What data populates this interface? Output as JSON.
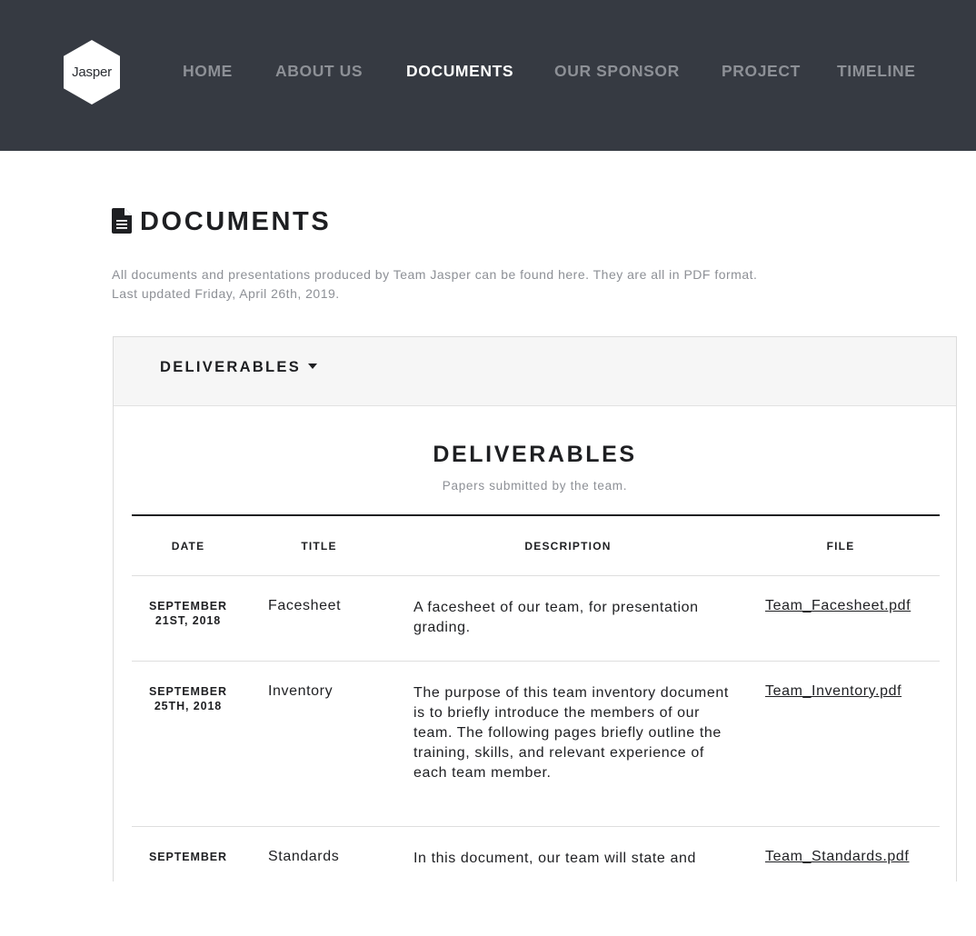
{
  "header": {
    "logo_text": "Jasper",
    "nav": [
      {
        "label": "HOME",
        "active": false
      },
      {
        "label": "ABOUT US",
        "active": false
      },
      {
        "label": "DOCUMENTS",
        "active": true
      },
      {
        "label": "OUR SPONSOR",
        "active": false
      },
      {
        "label": "PROJECT",
        "active": false
      },
      {
        "label": "TIMELINE",
        "active": false
      }
    ]
  },
  "page": {
    "icon": "document-icon",
    "title": "DOCUMENTS",
    "intro_line1": "All documents and presentations produced by Team Jasper can be found here. They are all in PDF format.",
    "intro_line2": "Last updated Friday, April 26th, 2019."
  },
  "panel": {
    "dropdown_label": "DELIVERABLES",
    "section_title": "DELIVERABLES",
    "section_subtitle": "Papers submitted by the team.",
    "columns": {
      "date": "DATE",
      "title": "TITLE",
      "description": "DESCRIPTION",
      "file": "FILE"
    },
    "rows": [
      {
        "date_line1": "SEPTEMBER",
        "date_line2": "21ST, 2018",
        "title": "Facesheet",
        "description": "A facesheet of our team, for presentation grading.",
        "file": "Team_Facesheet.pdf"
      },
      {
        "date_line1": "SEPTEMBER",
        "date_line2": "25TH, 2018",
        "title": "Inventory",
        "description": "The purpose of this team inventory document is to briefly introduce the members of our team. The following pages briefly outline the training, skills, and relevant experience of each team member.",
        "file": "Team_Inventory.pdf"
      },
      {
        "date_line1": "SEPTEMBER",
        "date_line2": "",
        "title": "Standards",
        "description": "In this document, our team will state and",
        "file": "Team_Standards.pdf"
      }
    ]
  },
  "colors": {
    "header_bg": "#363a42",
    "nav_inactive": "#8d9096",
    "nav_active": "#ffffff",
    "text_dark": "#1e1f22",
    "text_muted": "#8d9096",
    "panel_head_bg": "#f6f6f6"
  }
}
